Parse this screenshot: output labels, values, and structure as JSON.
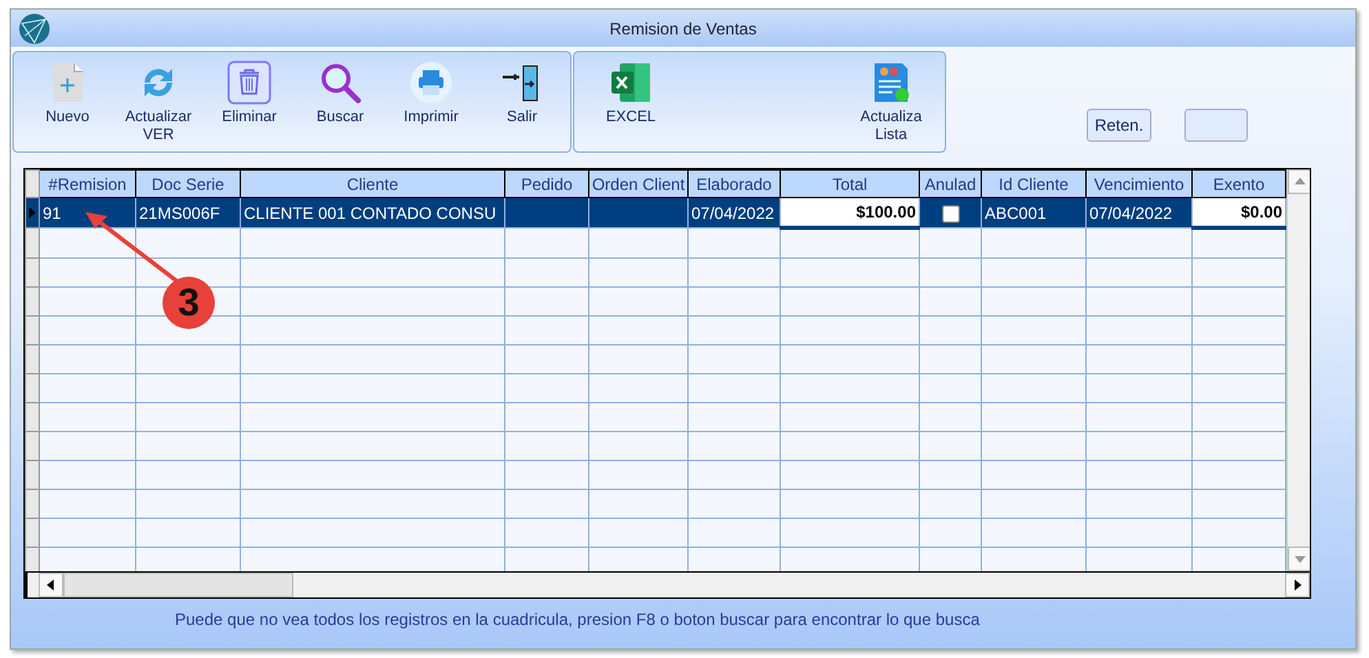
{
  "window": {
    "title": "Remision de Ventas"
  },
  "toolbar": [
    {
      "label": "Nuevo",
      "kind": "new"
    },
    {
      "label": "Actualizar VER",
      "kind": "refresh"
    },
    {
      "label": "Eliminar",
      "kind": "delete"
    },
    {
      "label": "Buscar",
      "kind": "search"
    },
    {
      "label": "Imprimir",
      "kind": "print"
    },
    {
      "label": "Salir",
      "kind": "exit"
    }
  ],
  "toolbar_2": [
    {
      "label": "EXCEL",
      "kind": "excel"
    },
    {
      "label": "Actualiza Lista",
      "kind": "list"
    }
  ],
  "side_buttons": [
    {
      "kind": "text",
      "label": "Reten."
    },
    {
      "kind": "blank"
    }
  ],
  "table": {
    "columns": [
      "#Remision",
      "Doc Serie",
      "Cliente",
      "Pedido",
      "Orden Client",
      "Elaborado",
      "Total",
      "Anulad",
      "Id Cliente",
      "Vencimiento",
      "Exento"
    ],
    "rows": [
      {
        "selected": true,
        "cells": [
          "91",
          "21MS006F",
          "CLIENTE 001 CONTADO CONSU",
          "",
          "",
          "07/04/2022",
          "$100.00",
          "",
          "ABC001",
          "07/04/2022",
          "$0.00"
        ],
        "anulado": false
      }
    ]
  },
  "status": "Puede que no vea todos los registros en la cuadricula, presion F8 o boton buscar para encontrar lo que busca",
  "annotation": {
    "label": "3"
  }
}
